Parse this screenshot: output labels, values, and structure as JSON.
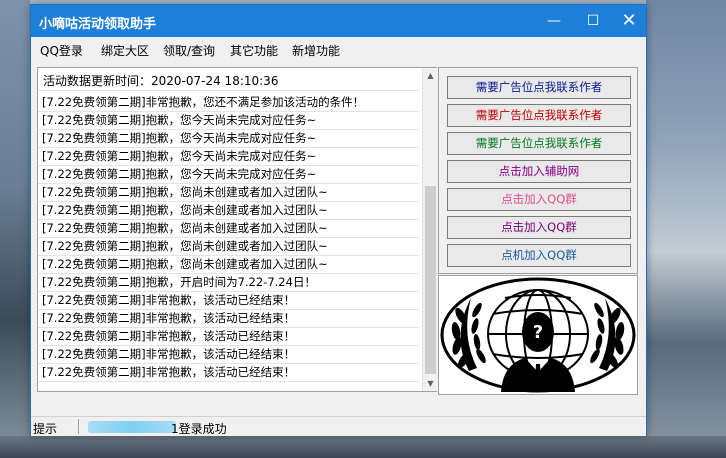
{
  "window": {
    "title": "小嘀咕活动领取助手",
    "minimize_glyph": "—",
    "maximize_glyph": "☐",
    "close_glyph": "✕"
  },
  "menu": [
    "QQ登录",
    "绑定大区",
    "领取/查询",
    "其它功能",
    "新增功能"
  ],
  "log": {
    "header": "活动数据更新时间：2020-07-24 18:10:36",
    "lines": [
      "[7.22免费领第二期]非常抱歉，您还不满足参加该活动的条件！",
      "[7.22免费领第二期]抱歉，您今天尚未完成对应任务~",
      "[7.22免费领第二期]抱歉，您今天尚未完成对应任务~",
      "[7.22免费领第二期]抱歉，您今天尚未完成对应任务~",
      "[7.22免费领第二期]抱歉，您今天尚未完成对应任务~",
      "[7.22免费领第二期]抱歉，您尚未创建或者加入过团队~",
      "[7.22免费领第二期]抱歉，您尚未创建或者加入过团队~",
      "[7.22免费领第二期]抱歉，您尚未创建或者加入过团队~",
      "[7.22免费领第二期]抱歉，您尚未创建或者加入过团队~",
      "[7.22免费领第二期]抱歉，您尚未创建或者加入过团队~",
      "[7.22免费领第二期]抱歉，开启时间为7.22-7.24日！",
      "[7.22免费领第二期]非常抱歉，该活动已经结束！",
      "[7.22免费领第二期]非常抱歉，该活动已经结束！",
      "[7.22免费领第二期]非常抱歉，该活动已经结束！",
      "[7.22免费领第二期]非常抱歉，该活动已经结束！",
      "[7.22免费领第二期]非常抱歉，该活动已经结束！"
    ]
  },
  "side_buttons": [
    {
      "label": "需要广告位点我联系作者",
      "color": "#0a1a8c"
    },
    {
      "label": "需要广告位点我联系作者",
      "color": "#c00000"
    },
    {
      "label": "需要广告位点我联系作者",
      "color": "#007a1e"
    },
    {
      "label": "点击加入辅助网",
      "color": "#8a008a"
    },
    {
      "label": "点击加入QQ群",
      "color": "#e0508a"
    },
    {
      "label": "点击加入QQ群",
      "color": "#7a007a"
    },
    {
      "label": "点机加入QQ群",
      "color": "#1a5a9a"
    }
  ],
  "status": {
    "label": "提示",
    "message": "1登录成功"
  },
  "colors": {
    "titlebar": "#1e7fd8",
    "window_bg": "#f0f0f0"
  },
  "icons": {
    "emblem": "anonymous-emblem-icon"
  }
}
